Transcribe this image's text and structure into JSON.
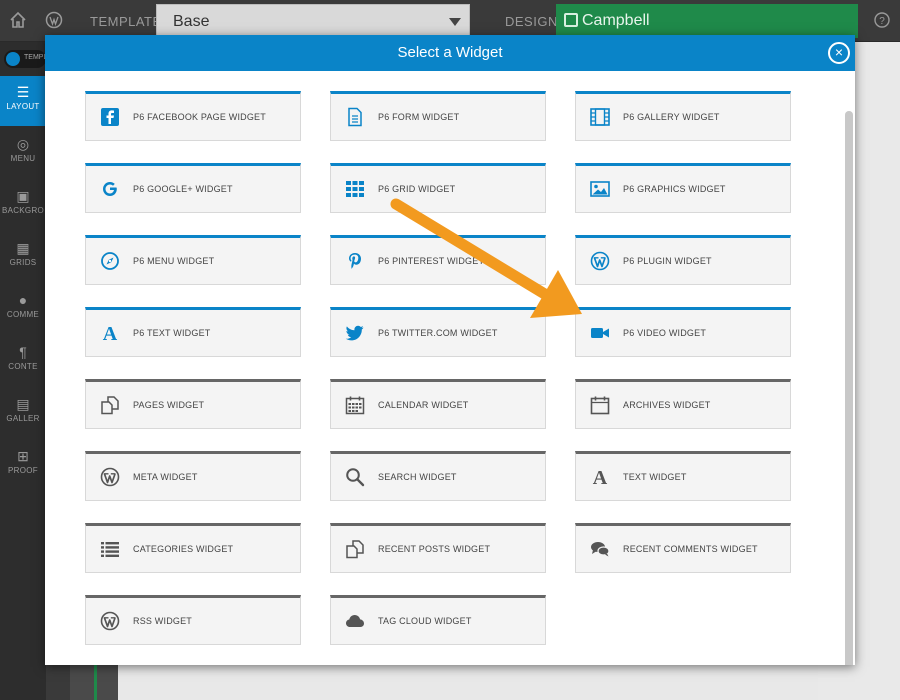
{
  "topbar": {
    "template_label": "TEMPLATE:",
    "template_value": "Base",
    "design_label": "DESIGN:",
    "design_value": "Campbell"
  },
  "sidebar": {
    "toggle_label": "TEMPL",
    "items": [
      {
        "label": "LAYOUT",
        "icon": "layout-icon"
      },
      {
        "label": "MENU",
        "icon": "compass-icon"
      },
      {
        "label": "BACKGRO",
        "icon": "image-icon"
      },
      {
        "label": "GRIDS",
        "icon": "grid-icon"
      },
      {
        "label": "COMME",
        "icon": "comment-icon"
      },
      {
        "label": "CONTE",
        "icon": "pilcrow-icon"
      },
      {
        "label": "GALLER",
        "icon": "film-icon"
      },
      {
        "label": "PROOF",
        "icon": "cart-icon"
      }
    ]
  },
  "modal": {
    "title": "Select a Widget",
    "close_symbol": "×",
    "widgets": [
      {
        "label": "P6 FACEBOOK PAGE WIDGET",
        "icon": "facebook-icon",
        "style": "blue"
      },
      {
        "label": "P6 FORM WIDGET",
        "icon": "document-icon",
        "style": "blue"
      },
      {
        "label": "P6 GALLERY WIDGET",
        "icon": "film-icon",
        "style": "blue"
      },
      {
        "label": "P6 GOOGLE+ WIDGET",
        "icon": "google-icon",
        "style": "blue"
      },
      {
        "label": "P6 GRID WIDGET",
        "icon": "grid-icon",
        "style": "blue"
      },
      {
        "label": "P6 GRAPHICS WIDGET",
        "icon": "image-icon",
        "style": "blue"
      },
      {
        "label": "P6 MENU WIDGET",
        "icon": "compass-icon",
        "style": "blue"
      },
      {
        "label": "P6 PINTEREST WIDGET",
        "icon": "pinterest-icon",
        "style": "blue"
      },
      {
        "label": "P6 PLUGIN WIDGET",
        "icon": "wordpress-icon",
        "style": "blue"
      },
      {
        "label": "P6 TEXT WIDGET",
        "icon": "text-icon",
        "style": "blue"
      },
      {
        "label": "P6 TWITTER.COM WIDGET",
        "icon": "twitter-icon",
        "style": "blue"
      },
      {
        "label": "P6 VIDEO WIDGET",
        "icon": "video-icon",
        "style": "blue"
      },
      {
        "label": "PAGES WIDGET",
        "icon": "pages-icon",
        "style": "gray"
      },
      {
        "label": "CALENDAR WIDGET",
        "icon": "calendar-icon",
        "style": "gray"
      },
      {
        "label": "ARCHIVES WIDGET",
        "icon": "archive-calendar-icon",
        "style": "gray"
      },
      {
        "label": "META WIDGET",
        "icon": "wordpress-icon",
        "style": "gray"
      },
      {
        "label": "SEARCH WIDGET",
        "icon": "search-icon",
        "style": "gray"
      },
      {
        "label": "TEXT WIDGET",
        "icon": "text-icon",
        "style": "gray"
      },
      {
        "label": "CATEGORIES WIDGET",
        "icon": "list-icon",
        "style": "gray"
      },
      {
        "label": "RECENT POSTS WIDGET",
        "icon": "pages-icon",
        "style": "gray"
      },
      {
        "label": "RECENT COMMENTS WIDGET",
        "icon": "comments-icon",
        "style": "gray"
      },
      {
        "label": "RSS WIDGET",
        "icon": "wordpress-icon",
        "style": "gray"
      },
      {
        "label": "TAG CLOUD WIDGET",
        "icon": "cloud-icon",
        "style": "gray"
      }
    ]
  },
  "colors": {
    "accent": "#0a84c8",
    "gray_bar": "#666666",
    "arrow": "#f29a1f",
    "design_green": "#1f8a4a"
  }
}
